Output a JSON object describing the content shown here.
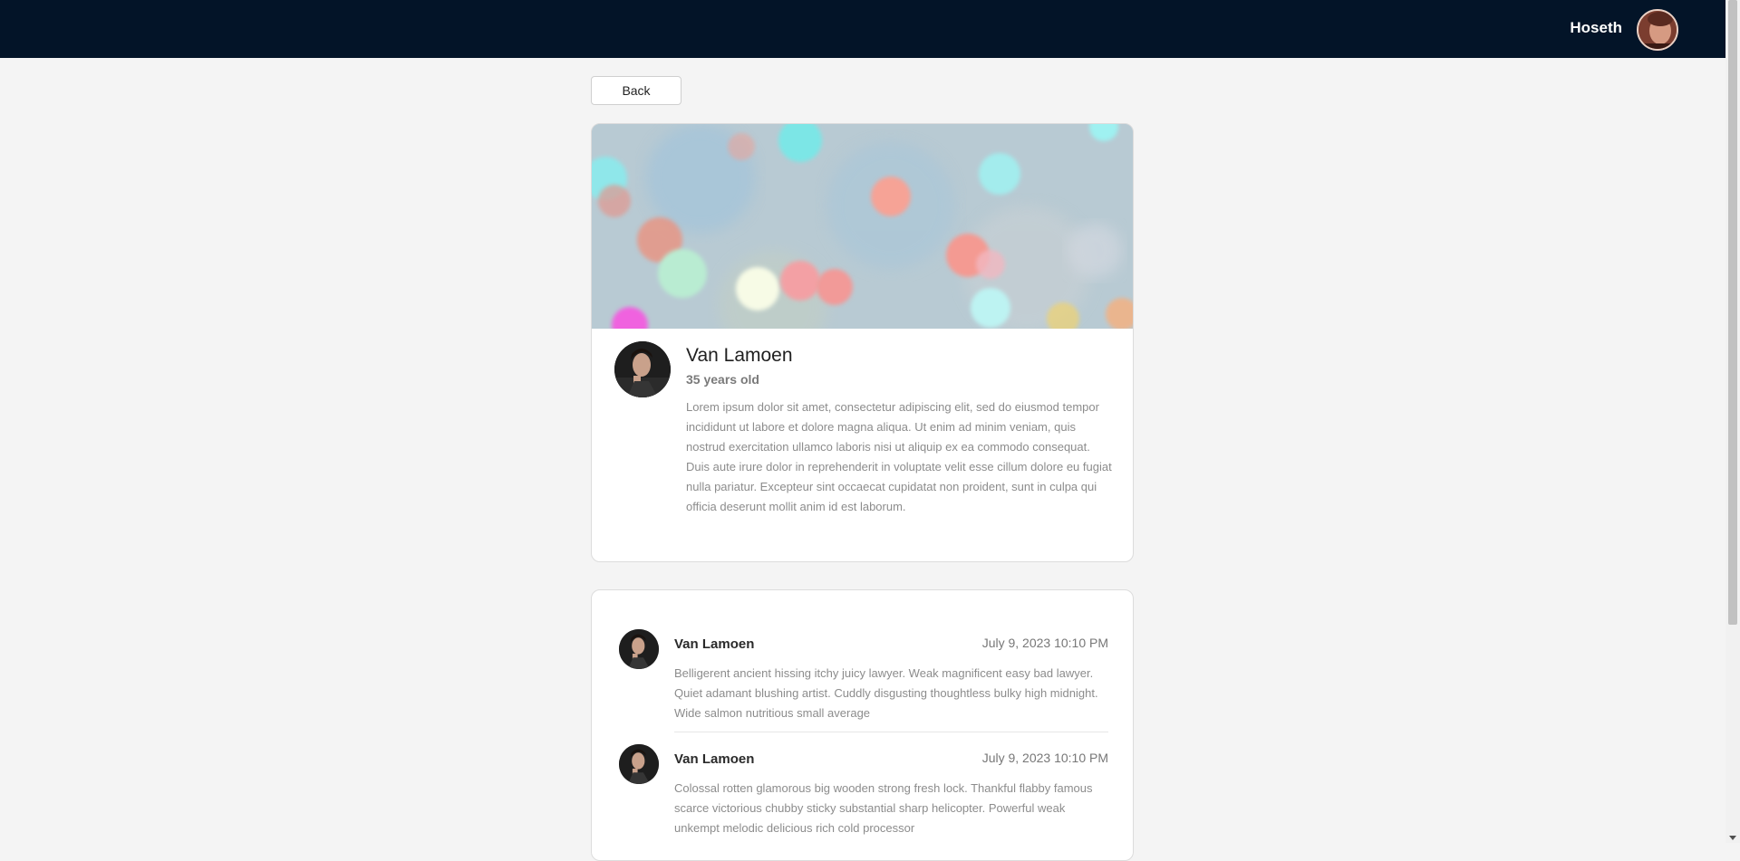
{
  "header": {
    "username": "Hoseth"
  },
  "back_label": "Back",
  "profile": {
    "name": "Van Lamoen",
    "age": "35 years old",
    "bio": "Lorem ipsum dolor sit amet, consectetur adipiscing elit, sed do eiusmod tempor incididunt ut labore et dolore magna aliqua. Ut enim ad minim veniam, quis nostrud exercitation ullamco laboris nisi ut aliquip ex ea commodo consequat. Duis aute irure dolor in reprehenderit in voluptate velit esse cillum dolore eu fugiat nulla pariatur. Excepteur sint occaecat cupidatat non proident, sunt in culpa qui officia deserunt mollit anim id est laborum."
  },
  "comments": [
    {
      "author": "Van Lamoen",
      "date": "July 9, 2023 10:10 PM",
      "text": "Belligerent ancient hissing itchy juicy lawyer. Weak magnificent easy bad lawyer. Quiet adamant blushing artist. Cuddly disgusting thoughtless bulky high midnight. Wide salmon nutritious small average"
    },
    {
      "author": "Van Lamoen",
      "date": "July 9, 2023 10:10 PM",
      "text": "Colossal rotten glamorous big wooden strong fresh lock. Thankful flabby famous scarce victorious chubby sticky substantial sharp helicopter. Powerful weak unkempt melodic delicious rich cold processor"
    }
  ],
  "colors": {
    "header_bg": "#031428",
    "page_bg": "#f4f4f4"
  }
}
